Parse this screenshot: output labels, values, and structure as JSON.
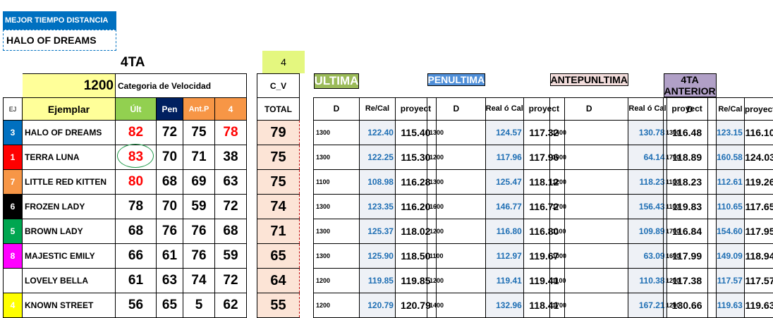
{
  "banner": "MEJOR TIEMPO DISTANCIA",
  "best_horse": "HALO OF DREAMS",
  "category": "4TA",
  "cv_value": "4",
  "distance": "1200",
  "speed_category_label": "Categoria de Velocidad",
  "cv_label": "C_V",
  "headers": {
    "ej": "EJ",
    "ejemplar": "Ejemplar",
    "ult": "Últ",
    "pen": "Pen",
    "antp": "Ant.P",
    "four": "4",
    "total": "TOTAL"
  },
  "sections": [
    {
      "title": "ULTIMA",
      "d": "D",
      "rc": "Re/Cal",
      "proj": "proyect"
    },
    {
      "title": "PENULTIMA",
      "d": "D",
      "rc": "Real ó Cal",
      "proj": "proyect"
    },
    {
      "title": "ANTEPUNLTIMA",
      "d": "D",
      "rc": "Real ó Cal",
      "proj": "proyect"
    },
    {
      "title": "4TA ANTERIOR",
      "d": "D",
      "rc": "Re/Cal",
      "proj": "proyect"
    }
  ],
  "rows": [
    {
      "ej": "3",
      "color": "blue",
      "name": "HALO OF DREAMS",
      "ult": "82",
      "pen": "72",
      "antp": "75",
      "four": "78",
      "total": "79",
      "s": [
        [
          "1300",
          "122.40",
          "115.40"
        ],
        [
          "1300",
          "124.57",
          "117.32"
        ],
        [
          "1400",
          "130.78",
          "116.48"
        ],
        [
          "1300",
          "123.15",
          "116.10"
        ]
      ]
    },
    {
      "ej": "1",
      "color": "red",
      "name": "TERRA LUNA",
      "ult": "83",
      "pen": "70",
      "antp": "71",
      "four": "38",
      "total": "75",
      "s": [
        [
          "1300",
          "122.25",
          "115.30"
        ],
        [
          "1200",
          "117.96",
          "117.96"
        ],
        [
          "1000",
          "64.14",
          "118.89"
        ],
        [
          "1700",
          "160.58",
          "124.03"
        ]
      ]
    },
    {
      "ej": "7",
      "color": "orange",
      "name": "LITTLE RED KITTEN",
      "ult": "80",
      "pen": "68",
      "antp": "69",
      "four": "63",
      "total": "75",
      "s": [
        [
          "1100",
          "108.98",
          "116.28"
        ],
        [
          "1300",
          "125.47",
          "118.12"
        ],
        [
          "1200",
          "118.23",
          "118.23"
        ],
        [
          "1100",
          "112.61",
          "119.26"
        ]
      ]
    },
    {
      "ej": "6",
      "color": "black",
      "name": "FROZEN LADY",
      "ult": "78",
      "pen": "70",
      "antp": "59",
      "four": "72",
      "total": "74",
      "s": [
        [
          "1300",
          "123.35",
          "116.20"
        ],
        [
          "1600",
          "146.77",
          "116.72"
        ],
        [
          "1700",
          "156.43",
          "119.83"
        ],
        [
          "1100",
          "110.65",
          "117.65"
        ]
      ]
    },
    {
      "ej": "5",
      "color": "green",
      "name": "BROWN LADY",
      "ult": "68",
      "pen": "76",
      "antp": "76",
      "four": "68",
      "total": "71",
      "s": [
        [
          "1300",
          "125.37",
          "118.02"
        ],
        [
          "1200",
          "116.80",
          "116.80"
        ],
        [
          "1100",
          "109.89",
          "116.84"
        ],
        [
          "1700",
          "154.60",
          "117.95"
        ]
      ]
    },
    {
      "ej": "8",
      "color": "pink",
      "name": "MAJESTIC EMILY",
      "ult": "66",
      "pen": "61",
      "antp": "76",
      "four": "59",
      "total": "65",
      "s": [
        [
          "1300",
          "125.90",
          "118.50"
        ],
        [
          "1100",
          "112.97",
          "119.67"
        ],
        [
          "1000",
          "63.09",
          "117.99"
        ],
        [
          "1600",
          "149.09",
          "118.94"
        ]
      ]
    },
    {
      "ej": "2",
      "color": "white",
      "name": "LOVELY BELLA",
      "ult": "61",
      "pen": "63",
      "antp": "74",
      "four": "72",
      "total": "64",
      "s": [
        [
          "1200",
          "119.85",
          "119.85"
        ],
        [
          "1200",
          "119.41",
          "119.41"
        ],
        [
          "1100",
          "110.38",
          "117.38"
        ],
        [
          "1200",
          "117.57",
          "117.57"
        ]
      ]
    },
    {
      "ej": "4",
      "color": "yellow",
      "name": "KNOWN STREET",
      "ult": "56",
      "pen": "65",
      "antp": "5",
      "four": "62",
      "total": "55",
      "s": [
        [
          "1200",
          "120.79",
          "120.79"
        ],
        [
          "1400",
          "132.96",
          "118.41"
        ],
        [
          "1700",
          "167.21",
          "130.66"
        ],
        [
          "1200",
          "119.63",
          "119.63"
        ]
      ]
    }
  ],
  "red_scores": [
    [
      0,
      "ult"
    ],
    [
      0,
      "four"
    ],
    [
      1,
      "ult"
    ],
    [
      2,
      "ult"
    ]
  ],
  "circled": [
    1,
    "ult"
  ]
}
